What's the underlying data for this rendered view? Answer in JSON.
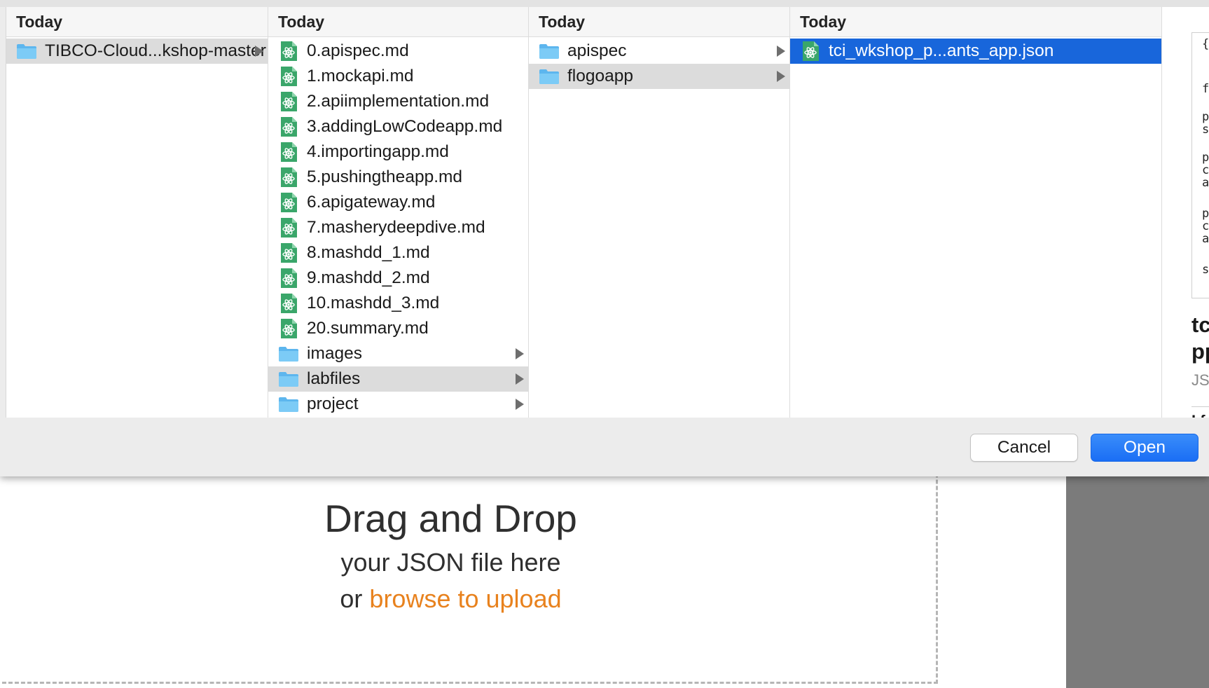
{
  "web": {
    "drop_title": "Drag and Drop",
    "drop_subtitle": "your JSON file here",
    "drop_or": "or",
    "drop_link": "browse to upload",
    "link_color": "#e8821e"
  },
  "dialog": {
    "columns": [
      {
        "header": "Today",
        "rows": [
          {
            "label": "TIBCO-Cloud...kshop-master",
            "icon": "folder-icon",
            "chevron": true,
            "selected": "gray"
          }
        ]
      },
      {
        "header": "Today",
        "rows": [
          {
            "label": "0.apispec.md",
            "icon": "atom-document-icon",
            "chevron": false,
            "selected": ""
          },
          {
            "label": "1.mockapi.md",
            "icon": "atom-document-icon",
            "chevron": false,
            "selected": ""
          },
          {
            "label": "2.apiimplementation.md",
            "icon": "atom-document-icon",
            "chevron": false,
            "selected": ""
          },
          {
            "label": "3.addingLowCodeapp.md",
            "icon": "atom-document-icon",
            "chevron": false,
            "selected": ""
          },
          {
            "label": "4.importingapp.md",
            "icon": "atom-document-icon",
            "chevron": false,
            "selected": ""
          },
          {
            "label": "5.pushingtheapp.md",
            "icon": "atom-document-icon",
            "chevron": false,
            "selected": ""
          },
          {
            "label": "6.apigateway.md",
            "icon": "atom-document-icon",
            "chevron": false,
            "selected": ""
          },
          {
            "label": "7.masherydeepdive.md",
            "icon": "atom-document-icon",
            "chevron": false,
            "selected": ""
          },
          {
            "label": "8.mashdd_1.md",
            "icon": "atom-document-icon",
            "chevron": false,
            "selected": ""
          },
          {
            "label": "9.mashdd_2.md",
            "icon": "atom-document-icon",
            "chevron": false,
            "selected": ""
          },
          {
            "label": "10.mashdd_3.md",
            "icon": "atom-document-icon",
            "chevron": false,
            "selected": ""
          },
          {
            "label": "20.summary.md",
            "icon": "atom-document-icon",
            "chevron": false,
            "selected": ""
          },
          {
            "label": "images",
            "icon": "folder-icon",
            "chevron": true,
            "selected": ""
          },
          {
            "label": "labfiles",
            "icon": "folder-icon",
            "chevron": true,
            "selected": "gray"
          },
          {
            "label": "project",
            "icon": "folder-icon",
            "chevron": true,
            "selected": ""
          }
        ]
      },
      {
        "header": "Today",
        "rows": [
          {
            "label": "apispec",
            "icon": "folder-icon",
            "chevron": true,
            "selected": ""
          },
          {
            "label": "flogoapp",
            "icon": "folder-icon",
            "chevron": true,
            "selected": "gray"
          }
        ]
      },
      {
        "header": "Today",
        "rows": [
          {
            "label": "tci_wkshop_p...ants_app.json",
            "icon": "atom-document-icon",
            "chevron": false,
            "selected": "blue"
          }
        ]
      }
    ],
    "preview": {
      "lines": [
        "{",
        "fl",
        "pr",
        "sr",
        "pr",
        "co",
        "ac",
        "pr",
        "co",
        "ac",
        "sv"
      ],
      "name": "tci\npp",
      "kind": "JSO",
      "more": "I f"
    },
    "buttons": {
      "cancel": "Cancel",
      "open": "Open"
    }
  },
  "colors": {
    "selection_blue": "#1866db",
    "selection_gray": "#dcdcdc",
    "folder": "#6cc3f2",
    "open_button": "#1a6ef5"
  }
}
